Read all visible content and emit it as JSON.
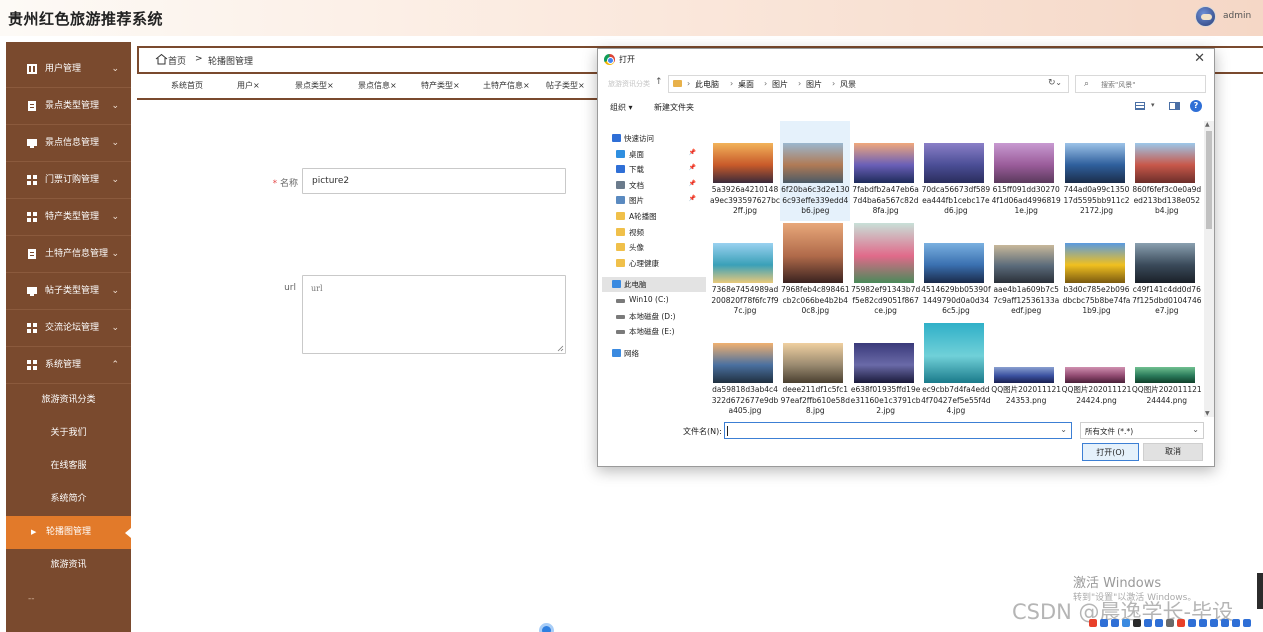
{
  "app": {
    "title": "贵州红色旅游推荐系统",
    "user_name": "admin"
  },
  "sidebar": {
    "items": [
      {
        "label": "用户管理",
        "arrow": "⌄"
      },
      {
        "label": "景点类型管理",
        "arrow": "⌄"
      },
      {
        "label": "景点信息管理",
        "arrow": "⌄"
      },
      {
        "label": "门票订购管理",
        "arrow": "⌄"
      },
      {
        "label": "特产类型管理",
        "arrow": "⌄"
      },
      {
        "label": "土特产信息管理",
        "arrow": "⌄"
      },
      {
        "label": "帖子类型管理",
        "arrow": "⌄"
      },
      {
        "label": "交流论坛管理",
        "arrow": "⌄"
      },
      {
        "label": "系统管理",
        "arrow": "⌃"
      }
    ],
    "sub_items": [
      {
        "label": "旅游资讯分类"
      },
      {
        "label": "关于我们"
      },
      {
        "label": "在线客服"
      },
      {
        "label": "系统简介"
      },
      {
        "label": "轮播图管理",
        "active": true
      },
      {
        "label": "旅游资讯"
      }
    ],
    "trailing": "--",
    "colors": {
      "bg": "#7a4a2e",
      "active": "#e27a2a"
    }
  },
  "breadcrumb": {
    "home": "首页",
    "separator": ">",
    "current": "轮播图管理"
  },
  "tabs": [
    {
      "label": "系统首页"
    },
    {
      "label": "用户×"
    },
    {
      "label": "景点类型×"
    },
    {
      "label": "景点信息×"
    },
    {
      "label": "特产类型×"
    },
    {
      "label": "土特产信息×"
    },
    {
      "label": "帖子类型×"
    }
  ],
  "form": {
    "name_required_mark": "*",
    "name_label": "名称",
    "name_value": "picture2",
    "url_label": "url",
    "url_placeholder": "url"
  },
  "dialog": {
    "title": "打开",
    "close": "✕",
    "nav_ghost": "旅游资讯分类",
    "address": {
      "segments": [
        "此电脑",
        "桌面",
        "图片",
        "图片",
        "风景"
      ],
      "chevron": "›",
      "dropdown": "⌄",
      "refresh": "↻"
    },
    "search_placeholder": "搜索\"风景\"",
    "toolbar": {
      "organize": "组织 ▾",
      "new_folder": "新建文件夹",
      "view_dropdown": "▾",
      "help": "?"
    },
    "nav_pane": [
      {
        "label": "快速访问",
        "icon": "star-icon",
        "level": 0,
        "pinned": false
      },
      {
        "label": "桌面",
        "icon": "desktop-icon",
        "level": 1,
        "pinned": true
      },
      {
        "label": "下载",
        "icon": "download-icon",
        "level": 1,
        "pinned": true
      },
      {
        "label": "文档",
        "icon": "document-icon",
        "level": 1,
        "pinned": true
      },
      {
        "label": "图片",
        "icon": "pictures-icon",
        "level": 1,
        "pinned": true
      },
      {
        "label": "A轮播图",
        "icon": "folder-icon",
        "level": 1,
        "pinned": false
      },
      {
        "label": "视频",
        "icon": "folder-icon",
        "level": 1,
        "pinned": false
      },
      {
        "label": "头像",
        "icon": "folder-icon",
        "level": 1,
        "pinned": false
      },
      {
        "label": "心理健康",
        "icon": "folder-icon",
        "level": 1,
        "pinned": false
      },
      {
        "label": "此电脑",
        "icon": "computer-icon",
        "level": 0,
        "pinned": false,
        "selected": true
      },
      {
        "label": "Win10 (C:)",
        "icon": "drive-icon",
        "level": 1,
        "pinned": false
      },
      {
        "label": "本地磁盘 (D:)",
        "icon": "drive-icon",
        "level": 1,
        "pinned": false
      },
      {
        "label": "本地磁盘 (E:)",
        "icon": "drive-icon",
        "level": 1,
        "pinned": false
      },
      {
        "label": "网络",
        "icon": "network-icon",
        "level": 0,
        "pinned": false
      }
    ],
    "files": [
      {
        "name": "5a3926a4210148a9ec393597627bc2ff.jpg",
        "colors": [
          "#f2b35a",
          "#c85a2a",
          "#3a2a3a"
        ]
      },
      {
        "name": "6f20ba6c3d2e1306c93effe339edd4b6.jpeg",
        "colors": [
          "#9ab7cf",
          "#b07a55",
          "#4a5a66"
        ],
        "hover": true
      },
      {
        "name": "7fabdfb2a47eb6a7d4ba6a567c82d8fa.jpg",
        "colors": [
          "#f0a87c",
          "#6a5fb8",
          "#1e2b5a"
        ]
      },
      {
        "name": "70dca56673df589ea444fb1cebc17ed6.jpg",
        "colors": [
          "#8a7fc7",
          "#4b4e96",
          "#2a2d5c"
        ]
      },
      {
        "name": "615ff091dd302704f1d06ad49968191e.jpg",
        "colors": [
          "#c89ad1",
          "#9a5c9a",
          "#5a3a5c"
        ]
      },
      {
        "name": "744ad0a99c135017d5595bb911c22172.jpg",
        "colors": [
          "#9dc3e8",
          "#2f5f9c",
          "#1b2d4a"
        ]
      },
      {
        "name": "860f6fef3c0e0a9ded213bd138e052b4.jpg",
        "colors": [
          "#9cc8ea",
          "#c8584a",
          "#6c2e2a"
        ]
      },
      {
        "name": "7368e7454989ad200820f78f6fc7f97c.jpg",
        "colors": [
          "#9ad1f0",
          "#3aa0b8",
          "#e8c97a"
        ]
      },
      {
        "name": "7968feb4c898461cb2c066be4b2b40c8.jpg",
        "colors": [
          "#e8a87a",
          "#b06a4a",
          "#3a2220"
        ]
      },
      {
        "name": "75982ef91343b7df5e82cd9051f867ce.jpg",
        "colors": [
          "#c8e0d8",
          "#e06a8a",
          "#4a8a5a"
        ]
      },
      {
        "name": "4514629bb05390f1449790d0a0d346c5.jpg",
        "colors": [
          "#7ab0e0",
          "#3a70b0",
          "#1a2a4a"
        ]
      },
      {
        "name": "aae4b1a609b7c57c9aff12536133aedf.jpeg",
        "colors": [
          "#c8b89a",
          "#5a6a7a",
          "#2a3038"
        ]
      },
      {
        "name": "b3d0c785e2b096dbcbc75b8be74fa1b9.jpg",
        "colors": [
          "#5a9ae0",
          "#f0c020",
          "#7a5a10"
        ]
      },
      {
        "name": "c49f141c4dd0d767f125dbd0104746e7.jpg",
        "colors": [
          "#8aa0b0",
          "#3a4a5a",
          "#1a2028"
        ]
      },
      {
        "name": "da59818d3ab4c4322d672677e9dba405.jpg",
        "colors": [
          "#f0b070",
          "#4a70a0",
          "#203040"
        ]
      },
      {
        "name": "deee211df1c5fc197eaf2ffb610e58d8.jpg",
        "colors": [
          "#f0d0a0",
          "#9a8a70",
          "#4a4030"
        ]
      },
      {
        "name": "e638f01935ffd19ee31160e1c3791cb2.jpg",
        "colors": [
          "#3a3a7a",
          "#6a6aa8",
          "#1a1a3a"
        ]
      },
      {
        "name": "ec9cbb7d4fa4edd4f70427ef5e55f4d4.jpg",
        "colors": [
          "#30b0c8",
          "#70d0d8",
          "#1a7a8a"
        ]
      },
      {
        "name": "QQ图片20201112124353.png",
        "colors": [
          "#8aa0d0",
          "#3a50a0",
          "#1a2050"
        ]
      },
      {
        "name": "QQ图片20201112124424.png",
        "colors": [
          "#d090b0",
          "#904a70",
          "#4a2038"
        ]
      },
      {
        "name": "QQ图片20201112124444.png",
        "colors": [
          "#70c090",
          "#2a7a5a",
          "#10402a"
        ]
      }
    ],
    "filename_label": "文件名(N):",
    "filename_value": "",
    "filename_dropdown": "⌄",
    "filetype": "所有文件 (*.*)",
    "filetype_dropdown": "⌄",
    "open_button": "打开(O)",
    "cancel_button": "取消"
  },
  "overlay": {
    "activate_title": "激活 Windows",
    "activate_sub": "转到\"设置\"以激活 Windows。",
    "watermark": "CSDN @晨逸学长-毕设"
  }
}
